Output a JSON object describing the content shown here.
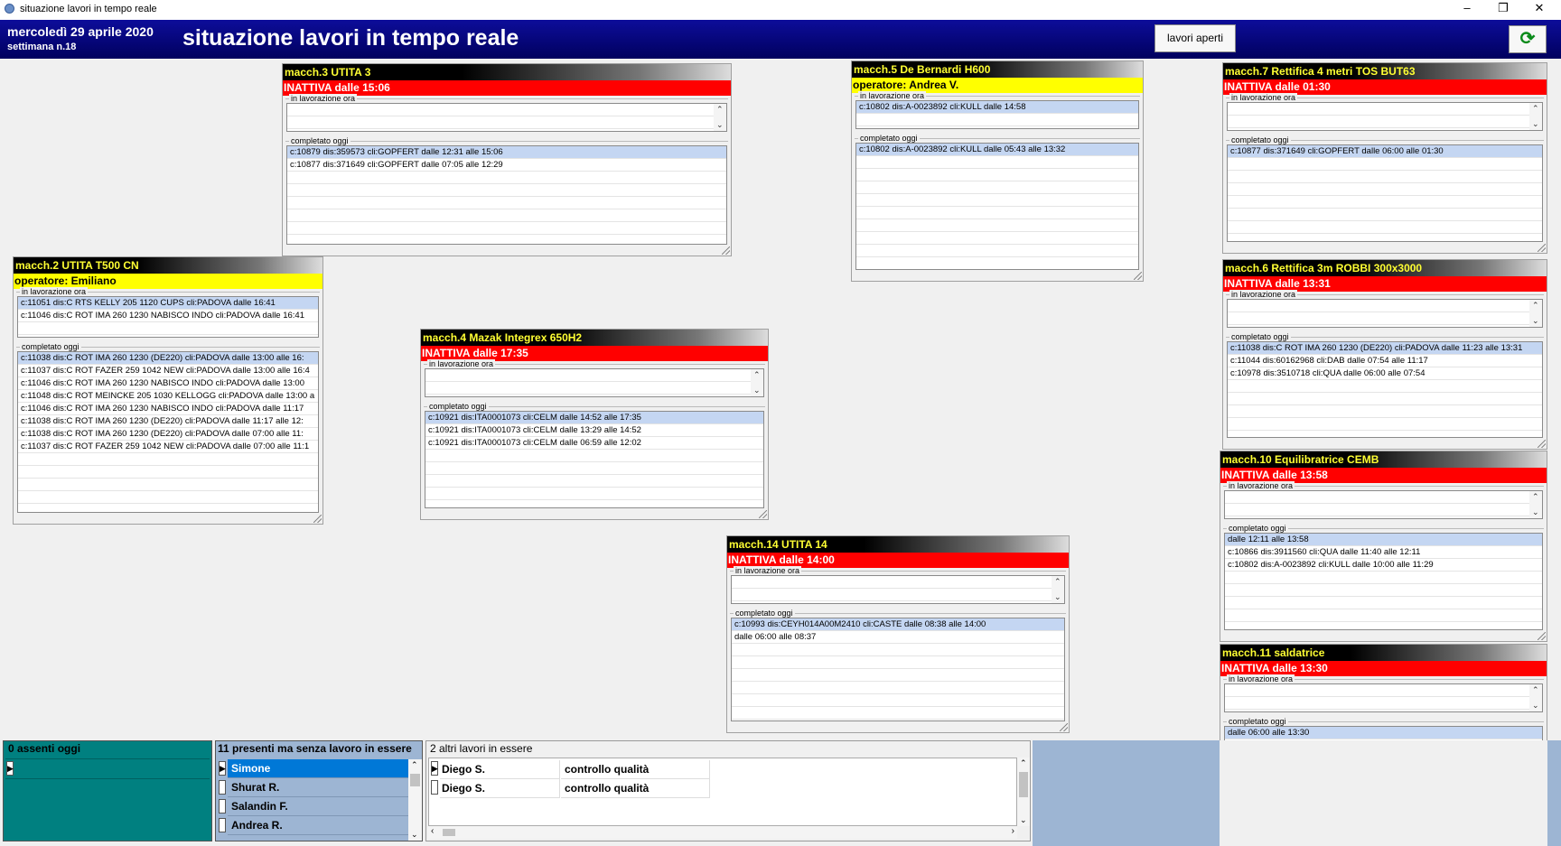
{
  "window": {
    "title": "situazione lavori in tempo reale"
  },
  "header": {
    "date": "mercoledì 29 aprile 2020",
    "week": "settimana n.18",
    "title": "situazione lavori in tempo reale",
    "open_jobs_button": "lavori aperti",
    "refresh_icon": "refresh-icon"
  },
  "colors": {
    "header": "#00005e",
    "status_inactive": "#ff0000",
    "status_operator": "#ffff00",
    "title_text": "#ffff33",
    "absent_panel": "#008080",
    "selected_row": "#c4d6f2"
  },
  "labels": {
    "now": "in lavorazione ora",
    "done": "completato oggi"
  },
  "machines": {
    "m3": {
      "title": "macch.3 UTITA  3",
      "status": "INATTIVA dalle 15:06",
      "now": [],
      "done": [
        "c:10879 dis:359573 cli:GOPFERT dalle 12:31 alle 15:06",
        "c:10877 dis:371649 cli:GOPFERT dalle 07:05 alle 12:29"
      ]
    },
    "m5": {
      "title": "macch.5 De Bernardi H600",
      "status": "operatore: Andrea V.",
      "now": [
        "c:10802 dis:A-0023892 cli:KULL dalle 14:58"
      ],
      "done": [
        "c:10802 dis:A-0023892 cli:KULL dalle 05:43 alle 13:32"
      ]
    },
    "m7": {
      "title": "macch.7 Rettifica 4 metri TOS BUT63",
      "status": "INATTIVA dalle 01:30",
      "now": [],
      "done": [
        "c:10877 dis:371649 cli:GOPFERT dalle 06:00 alle 01:30"
      ]
    },
    "m2": {
      "title": "macch.2 UTITA T500 CN",
      "status": "operatore: Emiliano",
      "now": [
        "c:11051 dis:C  RTS KELLY 205  1120  CUPS cli:PADOVA dalle 16:41",
        "c:11046 dis:C  ROT IMA 260  1230  NABISCO INDO cli:PADOVA dalle 16:41"
      ],
      "done": [
        "c:11038 dis:C  ROT IMA 260  1230 (DE220) cli:PADOVA dalle 13:00 alle 16:",
        "c:11037 dis:C  ROT FAZER 259  1042 NEW cli:PADOVA dalle 13:00 alle 16:4",
        "c:11046 dis:C  ROT IMA 260  1230  NABISCO INDO cli:PADOVA dalle 13:00",
        "c:11048 dis:C  ROT MEINCKE 205  1030  KELLOGG cli:PADOVA dalle 13:00 a",
        "c:11046 dis:C  ROT IMA 260  1230  NABISCO INDO cli:PADOVA dalle 11:17",
        "c:11038 dis:C  ROT IMA 260  1230 (DE220) cli:PADOVA dalle 11:17 alle 12:",
        "c:11038 dis:C  ROT IMA 260  1230 (DE220) cli:PADOVA dalle 07:00 alle 11:",
        "c:11037 dis:C  ROT FAZER 259  1042 NEW cli:PADOVA dalle 07:00 alle 11:1"
      ]
    },
    "m6": {
      "title": "macch.6 Rettifica 3m  ROBBI 300x3000",
      "status": "INATTIVA dalle 13:31",
      "now": [],
      "done": [
        "c:11038 dis:C  ROT IMA 260  1230 (DE220) cli:PADOVA dalle 11:23 alle 13:31",
        "c:11044 dis:60162968 cli:DAB dalle 07:54 alle 11:17",
        "c:10978 dis:3510718 cli:QUA dalle 06:00 alle 07:54"
      ]
    },
    "m4": {
      "title": "macch.4 Mazak Integrex 650H2",
      "status": "INATTIVA dalle 17:35",
      "now": [],
      "done": [
        "c:10921 dis:ITA0001073 cli:CELM dalle 14:52 alle 17:35",
        "c:10921 dis:ITA0001073 cli:CELM dalle 13:29 alle 14:52",
        "c:10921 dis:ITA0001073 cli:CELM dalle 06:59 alle 12:02"
      ]
    },
    "m10": {
      "title": "macch.10 Equilibratrice CEMB",
      "status": "INATTIVA dalle 13:58",
      "now": [],
      "done": [
        "dalle 12:11 alle 13:58",
        "c:10866 dis:3911560 cli:QUA dalle 11:40 alle 12:11",
        "c:10802 dis:A-0023892 cli:KULL dalle 10:00 alle 11:29"
      ]
    },
    "m14": {
      "title": "macch.14 UTITA 14",
      "status": "INATTIVA dalle 14:00",
      "now": [],
      "done": [
        "c:10993 dis:CEYH014A00M2410 cli:CASTE dalle 08:38 alle 14:00",
        "dalle 06:00 alle 08:37"
      ]
    },
    "m11": {
      "title": "macch.11 saldatrice",
      "status": "INATTIVA dalle 13:30",
      "now": [],
      "done": [
        "dalle 06:00 alle 13:30"
      ]
    }
  },
  "bottom": {
    "absent_label": "0 assenti oggi",
    "present_label": "11 presenti ma senza lavoro in essere",
    "present_list": [
      "Simone",
      "Shurat R.",
      "Salandin F.",
      "Andrea R."
    ],
    "other_label": "2 altri lavori in essere",
    "other_rows": [
      {
        "name": "Diego S.",
        "task": "controllo qualità"
      },
      {
        "name": "Diego S.",
        "task": "controllo qualità"
      }
    ]
  }
}
